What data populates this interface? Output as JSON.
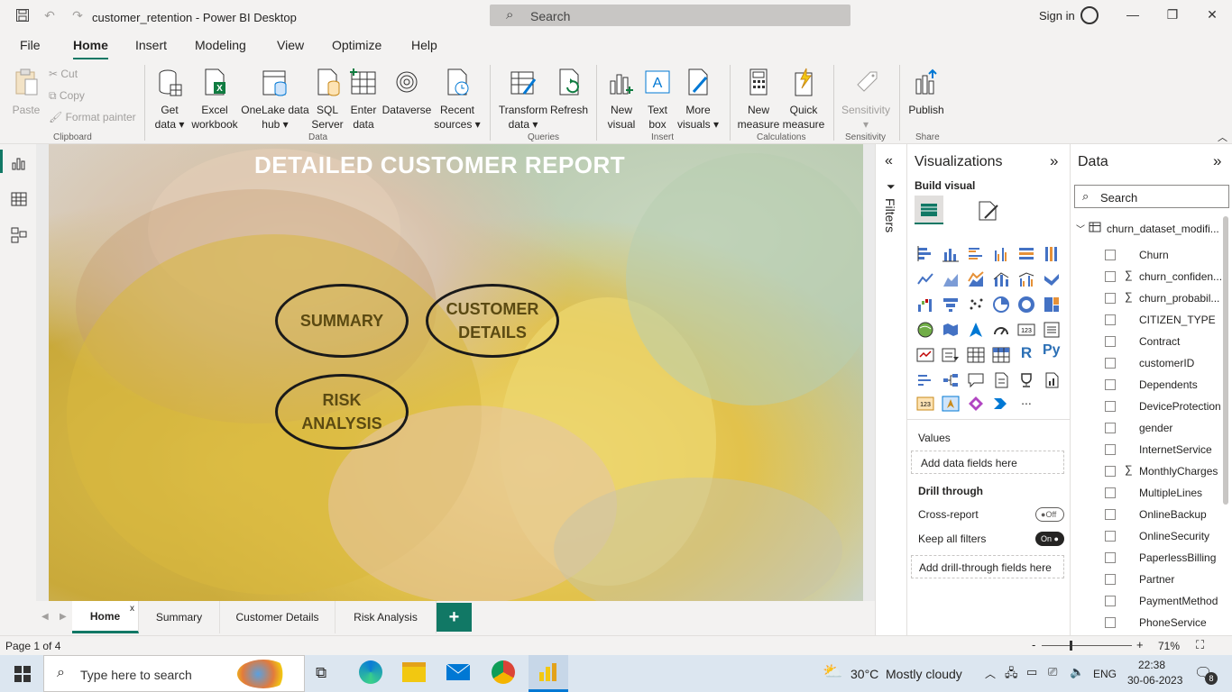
{
  "window": {
    "title": "customer_retention - Power BI Desktop",
    "search_placeholder": "Search",
    "signin": "Sign in"
  },
  "menu": {
    "tabs": [
      "File",
      "Home",
      "Insert",
      "Modeling",
      "View",
      "Optimize",
      "Help"
    ],
    "active": "Home"
  },
  "ribbon": {
    "clipboard": {
      "paste": "Paste",
      "cut": "Cut",
      "copy": "Copy",
      "format_painter": "Format painter",
      "label": "Clipboard"
    },
    "data": {
      "get_data_1": "Get",
      "get_data_2": "data",
      "excel_1": "Excel",
      "excel_2": "workbook",
      "onelake_1": "OneLake data",
      "onelake_2": "hub",
      "sql_1": "SQL",
      "sql_2": "Server",
      "enter_1": "Enter",
      "enter_2": "data",
      "dataverse": "Dataverse",
      "recent_1": "Recent",
      "recent_2": "sources",
      "label": "Data"
    },
    "queries": {
      "transform_1": "Transform",
      "transform_2": "data",
      "refresh": "Refresh",
      "label": "Queries"
    },
    "insert": {
      "new_visual_1": "New",
      "new_visual_2": "visual",
      "text_box_1": "Text",
      "text_box_2": "box",
      "more_visuals_1": "More",
      "more_visuals_2": "visuals",
      "label": "Insert"
    },
    "calculations": {
      "new_measure_1": "New",
      "new_measure_2": "measure",
      "quick_measure_1": "Quick",
      "quick_measure_2": "measure",
      "label": "Calculations"
    },
    "sensitivity": {
      "button": "Sensitivity",
      "label": "Sensitivity"
    },
    "share": {
      "publish": "Publish",
      "label": "Share"
    }
  },
  "report": {
    "title": "DETAILED CUSTOMER REPORT",
    "buttons": {
      "summary": "SUMMARY",
      "customer_1": "CUSTOMER",
      "customer_2": "DETAILS",
      "risk_1": "RISK",
      "risk_2": "ANALYSIS"
    }
  },
  "filters": {
    "label": "Filters"
  },
  "visualizations": {
    "title": "Visualizations",
    "build_visual": "Build visual",
    "values_label": "Values",
    "values_placeholder": "Add data fields here",
    "drill_through": "Drill through",
    "cross_report": "Cross-report",
    "cross_report_state": "Off",
    "keep_all_filters": "Keep all filters",
    "keep_all_filters_state": "On",
    "drill_placeholder": "Add drill-through fields here",
    "r_visual": "R",
    "py_visual": "Py",
    "more_ellipsis": "..."
  },
  "data_pane": {
    "title": "Data",
    "search_placeholder": "Search",
    "table_name": "churn_dataset_modifi...",
    "fields": [
      {
        "name": "Churn",
        "sigma": false
      },
      {
        "name": "churn_confiden...",
        "sigma": true
      },
      {
        "name": "churn_probabil...",
        "sigma": true
      },
      {
        "name": "CITIZEN_TYPE",
        "sigma": false
      },
      {
        "name": "Contract",
        "sigma": false
      },
      {
        "name": "customerID",
        "sigma": false
      },
      {
        "name": "Dependents",
        "sigma": false
      },
      {
        "name": "DeviceProtection",
        "sigma": false
      },
      {
        "name": "gender",
        "sigma": false
      },
      {
        "name": "InternetService",
        "sigma": false
      },
      {
        "name": "MonthlyCharges",
        "sigma": true
      },
      {
        "name": "MultipleLines",
        "sigma": false
      },
      {
        "name": "OnlineBackup",
        "sigma": false
      },
      {
        "name": "OnlineSecurity",
        "sigma": false
      },
      {
        "name": "PaperlessBilling",
        "sigma": false
      },
      {
        "name": "Partner",
        "sigma": false
      },
      {
        "name": "PaymentMethod",
        "sigma": false
      },
      {
        "name": "PhoneService",
        "sigma": false
      }
    ]
  },
  "page_tabs": [
    "Home",
    "Summary",
    "Customer Details",
    "Risk Analysis"
  ],
  "page_tab_close": "x",
  "status": {
    "page": "Page 1 of 4",
    "zoom": "71%",
    "zoom_minus": "-",
    "zoom_plus": "+"
  },
  "taskbar": {
    "search_placeholder": "Type here to search",
    "temperature": "30°C",
    "weather": "Mostly cloudy",
    "language": "ENG",
    "time": "22:38",
    "date": "30-06-2023",
    "notifications": "8"
  },
  "colors": {
    "accent": "#117865",
    "ribbon_bg": "#f3f2f1",
    "button_text": "#5b4a12"
  }
}
